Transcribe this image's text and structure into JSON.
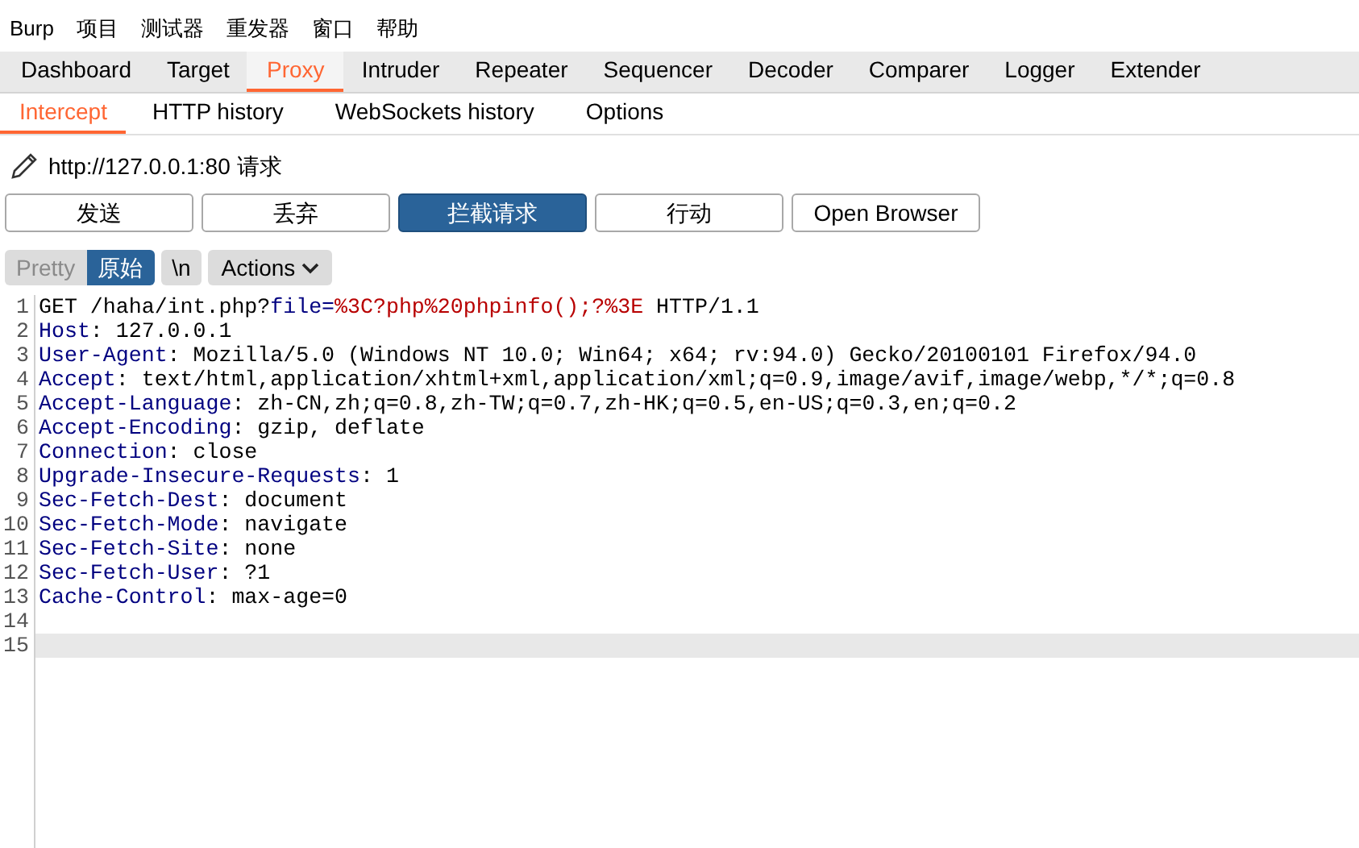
{
  "menu": [
    "Burp",
    "项目",
    "测试器",
    "重发器",
    "窗口",
    "帮助"
  ],
  "tabs": [
    {
      "label": "Dashboard",
      "selected": false
    },
    {
      "label": "Target",
      "selected": false
    },
    {
      "label": "Proxy",
      "selected": true
    },
    {
      "label": "Intruder",
      "selected": false
    },
    {
      "label": "Repeater",
      "selected": false
    },
    {
      "label": "Sequencer",
      "selected": false
    },
    {
      "label": "Decoder",
      "selected": false
    },
    {
      "label": "Comparer",
      "selected": false
    },
    {
      "label": "Logger",
      "selected": false
    },
    {
      "label": "Extender",
      "selected": false
    }
  ],
  "subtabs": [
    {
      "label": "Intercept",
      "selected": true
    },
    {
      "label": "HTTP history",
      "selected": false
    },
    {
      "label": "WebSockets history",
      "selected": false
    },
    {
      "label": "Options",
      "selected": false
    }
  ],
  "request_title": "http://127.0.0.1:80 请求",
  "buttons": [
    {
      "label": "发送",
      "on": false
    },
    {
      "label": "丢弃",
      "on": false
    },
    {
      "label": "拦截请求",
      "on": true
    },
    {
      "label": "行动",
      "on": false
    },
    {
      "label": "Open Browser",
      "on": false
    }
  ],
  "view_toggle": [
    {
      "label": "Pretty",
      "selected": false
    },
    {
      "label": "原始",
      "selected": true
    }
  ],
  "newline_button": "\\n",
  "actions_button": "Actions",
  "editor_lines": [
    {
      "number": "1",
      "selected": false,
      "segments": [
        {
          "kind": "plain",
          "text": "GET /haha/int.php?"
        },
        {
          "kind": "name",
          "text": "file="
        },
        {
          "kind": "value",
          "text": "%3C?php%20phpinfo();?%3E"
        },
        {
          "kind": "plain",
          "text": " HTTP/1.1"
        }
      ]
    },
    {
      "number": "2",
      "selected": false,
      "segments": [
        {
          "kind": "name",
          "text": "Host"
        },
        {
          "kind": "plain",
          "text": ": 127.0.0.1"
        }
      ]
    },
    {
      "number": "3",
      "selected": false,
      "segments": [
        {
          "kind": "name",
          "text": "User-Agent"
        },
        {
          "kind": "plain",
          "text": ": Mozilla/5.0 (Windows NT 10.0; Win64; x64; rv:94.0) Gecko/20100101 Firefox/94.0"
        }
      ]
    },
    {
      "number": "4",
      "selected": false,
      "segments": [
        {
          "kind": "name",
          "text": "Accept"
        },
        {
          "kind": "plain",
          "text": ": text/html,application/xhtml+xml,application/xml;q=0.9,image/avif,image/webp,*/*;q=0.8"
        }
      ]
    },
    {
      "number": "5",
      "selected": false,
      "segments": [
        {
          "kind": "name",
          "text": "Accept-Language"
        },
        {
          "kind": "plain",
          "text": ": zh-CN,zh;q=0.8,zh-TW;q=0.7,zh-HK;q=0.5,en-US;q=0.3,en;q=0.2"
        }
      ]
    },
    {
      "number": "6",
      "selected": false,
      "segments": [
        {
          "kind": "name",
          "text": "Accept-Encoding"
        },
        {
          "kind": "plain",
          "text": ": gzip, deflate"
        }
      ]
    },
    {
      "number": "7",
      "selected": false,
      "segments": [
        {
          "kind": "name",
          "text": "Connection"
        },
        {
          "kind": "plain",
          "text": ": close"
        }
      ]
    },
    {
      "number": "8",
      "selected": false,
      "segments": [
        {
          "kind": "name",
          "text": "Upgrade-Insecure-Requests"
        },
        {
          "kind": "plain",
          "text": ": 1"
        }
      ]
    },
    {
      "number": "9",
      "selected": false,
      "segments": [
        {
          "kind": "name",
          "text": "Sec-Fetch-Dest"
        },
        {
          "kind": "plain",
          "text": ": document"
        }
      ]
    },
    {
      "number": "10",
      "selected": false,
      "segments": [
        {
          "kind": "name",
          "text": "Sec-Fetch-Mode"
        },
        {
          "kind": "plain",
          "text": ": navigate"
        }
      ]
    },
    {
      "number": "11",
      "selected": false,
      "segments": [
        {
          "kind": "name",
          "text": "Sec-Fetch-Site"
        },
        {
          "kind": "plain",
          "text": ": none"
        }
      ]
    },
    {
      "number": "12",
      "selected": false,
      "segments": [
        {
          "kind": "name",
          "text": "Sec-Fetch-User"
        },
        {
          "kind": "plain",
          "text": ": ?1"
        }
      ]
    },
    {
      "number": "13",
      "selected": false,
      "segments": [
        {
          "kind": "name",
          "text": "Cache-Control"
        },
        {
          "kind": "plain",
          "text": ": max-age=0"
        }
      ]
    },
    {
      "number": "14",
      "selected": false
    },
    {
      "number": "15",
      "selected": true
    }
  ]
}
